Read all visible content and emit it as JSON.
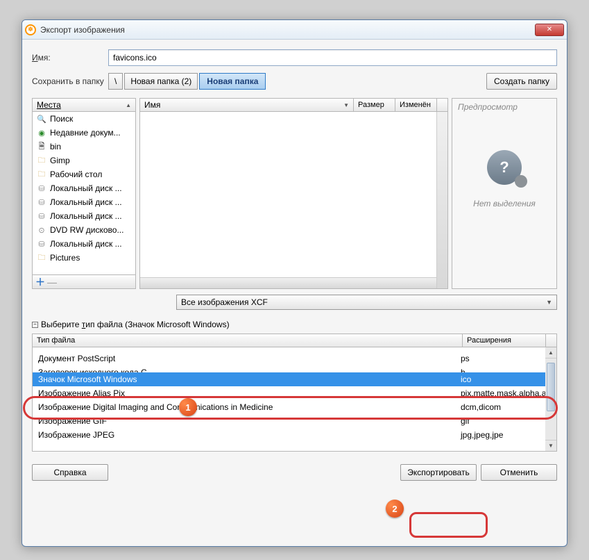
{
  "window": {
    "title": "Экспорт изображения"
  },
  "name": {
    "label": "Имя:",
    "value": "favicons.ico"
  },
  "save_in": {
    "label": "Сохранить в папку",
    "path_btn": "\\",
    "seg1": "Новая папка (2)",
    "seg2": "Новая папка",
    "create_btn": "Создать папку"
  },
  "places": {
    "header": "Места",
    "items": [
      {
        "icon": "search-icon",
        "label": "Поиск"
      },
      {
        "icon": "recent-icon",
        "label": "Недавние докум..."
      },
      {
        "icon": "file-icon",
        "label": "bin"
      },
      {
        "icon": "folder-icon",
        "label": "Gimp"
      },
      {
        "icon": "folder-icon",
        "label": "Рабочий стол"
      },
      {
        "icon": "drive-icon",
        "label": "Локальный диск ..."
      },
      {
        "icon": "drive-icon",
        "label": "Локальный диск ..."
      },
      {
        "icon": "drive-icon",
        "label": "Локальный диск ..."
      },
      {
        "icon": "dvd-icon",
        "label": "DVD RW дисково..."
      },
      {
        "icon": "drive-icon",
        "label": "Локальный диск ..."
      },
      {
        "icon": "folder-icon",
        "label": "Pictures"
      }
    ]
  },
  "files": {
    "col_name": "Имя",
    "col_size": "Размер",
    "col_modified": "Изменён"
  },
  "preview": {
    "title": "Предпросмотр",
    "caption": "Нет выделения"
  },
  "filter": {
    "selected": "Все изображения XCF"
  },
  "filetype_section": {
    "toggle_label": "Выберите тип файла (Значок Microsoft Windows)"
  },
  "ft_headers": {
    "type": "Тип файла",
    "ext": "Расширения"
  },
  "ft_rows": [
    {
      "type": "Документ PostScript",
      "ext": "ps",
      "sel": false
    },
    {
      "type": "Заголовок исходного кода С",
      "ext": "h",
      "sel": false,
      "truncated": true
    },
    {
      "type": "Значок Microsoft Windows",
      "ext": "ico",
      "sel": true
    },
    {
      "type": "Изображение Alias Pix",
      "ext": "pix,matte,mask,alpha,als",
      "sel": false
    },
    {
      "type": "Изображение Digital Imaging and Communications in Medicine",
      "ext": "dcm,dicom",
      "sel": false
    },
    {
      "type": "Изображение GIF",
      "ext": "gif",
      "sel": false
    },
    {
      "type": "Изображение JPEG",
      "ext": "jpg,jpeg,jpe",
      "sel": false
    }
  ],
  "buttons": {
    "help": "Справка",
    "export": "Экспортировать",
    "cancel": "Отменить"
  },
  "annotations": {
    "num1": "1",
    "num2": "2"
  }
}
